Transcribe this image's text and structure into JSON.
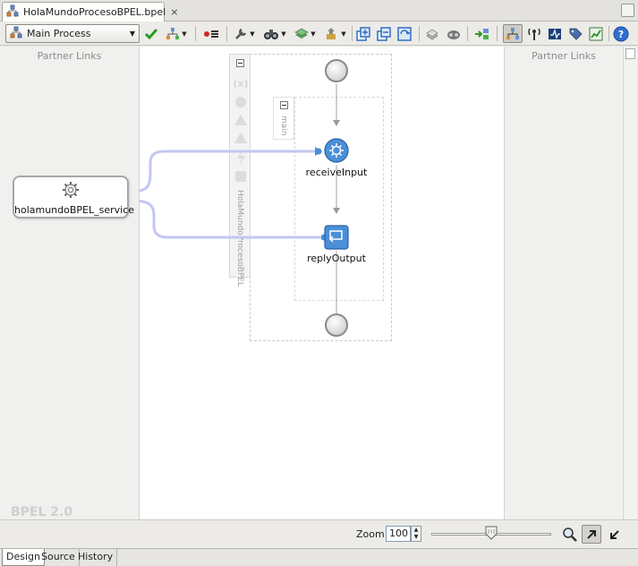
{
  "editor_tab": {
    "title": "HolaMundoProcesoBPEL.bpel",
    "close": "×"
  },
  "toolbar": {
    "process_select": "Main Process",
    "buttons": [
      "validate",
      "structure",
      "breakpoints",
      "wrench",
      "binoculars",
      "skin",
      "deploy",
      "expand",
      "collapse",
      "refresh",
      "schema",
      "preview",
      "insert",
      "process-view",
      "monitor",
      "sensors",
      "annotation",
      "analytics",
      "help"
    ],
    "help_label": "?"
  },
  "left_panel": {
    "title": "Partner Links",
    "version": "BPEL 2.0"
  },
  "right_panel": {
    "title": "Partner Links"
  },
  "canvas": {
    "process_name": "HolaMundoProcesoBPEL",
    "sequence_name": "main",
    "partner_link": "holamundoBPEL_service",
    "activities": [
      {
        "name": "receiveInput",
        "type": "receive"
      },
      {
        "name": "replyOutput",
        "type": "reply"
      }
    ]
  },
  "bottom": {
    "zoom_label": "Zoom:",
    "zoom_value": "100",
    "tabs": [
      "Design",
      "Source",
      "History"
    ],
    "active_tab": "Design"
  },
  "colors": {
    "accent": "#4a8fd8",
    "link_line": "#c3c7f2",
    "flow_line": "#a0a0a0"
  }
}
